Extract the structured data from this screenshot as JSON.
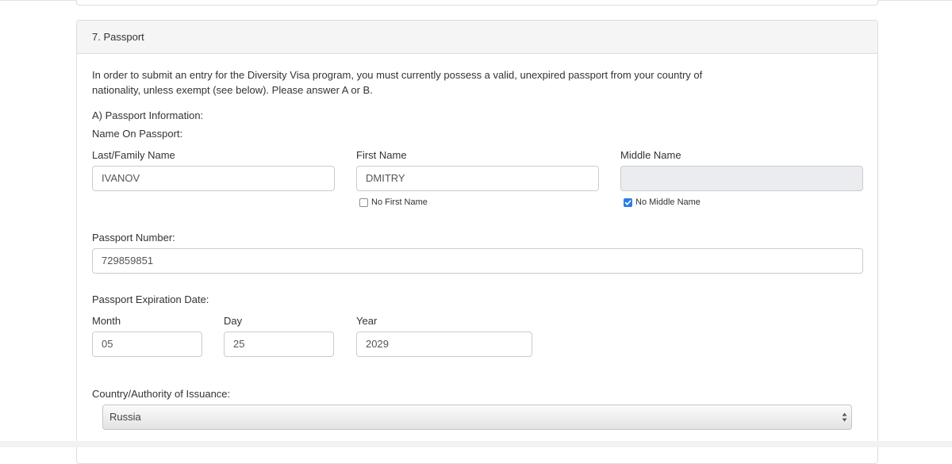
{
  "section": {
    "title": "7. Passport",
    "intro": "In order to submit an entry for the Diversity Visa program, you must currently possess a valid, unexpired passport from your country of nationality, unless exempt (see below). Please answer A or B."
  },
  "passport_info": {
    "heading": "A) Passport Information:",
    "name_on_passport_label": "Name On Passport:",
    "last_name": {
      "label": "Last/Family Name",
      "value": "IVANOV"
    },
    "first_name": {
      "label": "First Name",
      "value": "DMITRY",
      "no_first_name_label": "No First Name",
      "no_first_name_checked": false
    },
    "middle_name": {
      "label": "Middle Name",
      "value": "",
      "no_middle_name_label": "No Middle Name",
      "no_middle_name_checked": true
    },
    "passport_number": {
      "label": "Passport Number:",
      "value": "729859851"
    },
    "expiration": {
      "label": "Passport Expiration Date:",
      "month_label": "Month",
      "month_value": "05",
      "day_label": "Day",
      "day_value": "25",
      "year_label": "Year",
      "year_value": "2029"
    },
    "country": {
      "label": "Country/Authority of Issuance:",
      "selected": "Russia"
    }
  },
  "colors": {
    "accent": "#2b7de9",
    "border": "#cccccc",
    "panel_heading_bg": "#f5f5f5",
    "disabled_input_bg": "#eaecef"
  }
}
